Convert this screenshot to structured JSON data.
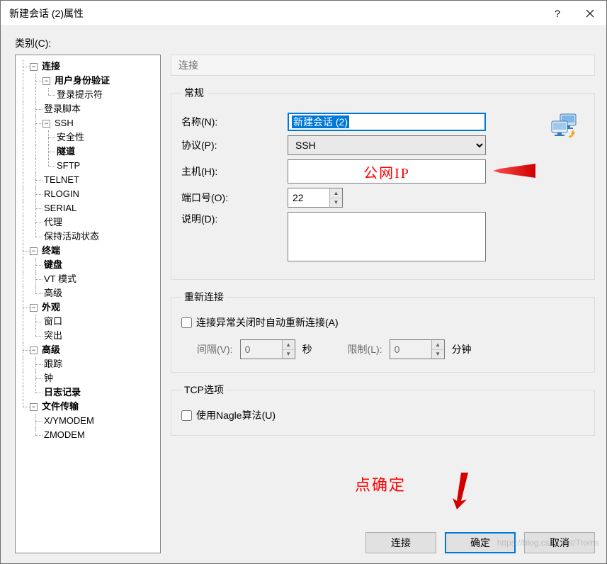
{
  "window": {
    "title": "新建会话 (2)属性",
    "help_symbol": "?",
    "close_symbol": "×"
  },
  "category_label": "类别(C):",
  "tree": {
    "connection": "连接",
    "user_auth": "用户身份验证",
    "login_prompt": "登录提示符",
    "login_script": "登录脚本",
    "ssh": "SSH",
    "security": "安全性",
    "tunnel": "隧道",
    "sftp": "SFTP",
    "telnet": "TELNET",
    "rlogin": "RLOGIN",
    "serial": "SERIAL",
    "proxy": "代理",
    "keepalive": "保持活动状态",
    "terminal": "终端",
    "keyboard": "键盘",
    "vtmode": "VT 模式",
    "advanced_term": "高级",
    "appearance": "外观",
    "window": "窗口",
    "highlight": "突出",
    "advanced": "高级",
    "trace": "跟踪",
    "bell": "钟",
    "logging": "日志记录",
    "filetransfer": "文件传输",
    "xymodem": "X/YMODEM",
    "zmodem": "ZMODEM"
  },
  "panel": {
    "header": "连接",
    "group_general": "常规",
    "name_label": "名称(N):",
    "name_value": "新建会话 (2)",
    "protocol_label": "协议(P):",
    "protocol_value": "SSH",
    "host_label": "主机(H):",
    "host_placeholder": "公网IP",
    "port_label": "端口号(O):",
    "port_value": "22",
    "desc_label": "说明(D):",
    "desc_value": "",
    "group_reconnect": "重新连接",
    "reconnect_cb": "连接异常关闭时自动重新连接(A)",
    "interval_label": "间隔(V):",
    "interval_value": "0",
    "interval_unit": "秒",
    "limit_label": "限制(L):",
    "limit_value": "0",
    "limit_unit": "分钟",
    "group_tcp": "TCP选项",
    "nagle_cb": "使用Nagle算法(U)"
  },
  "annotations": {
    "click_ok": "点确定"
  },
  "buttons": {
    "connect": "连接",
    "ok": "确定",
    "cancel": "取消"
  },
  "watermark": "https://blog.csdn.net/Troms"
}
